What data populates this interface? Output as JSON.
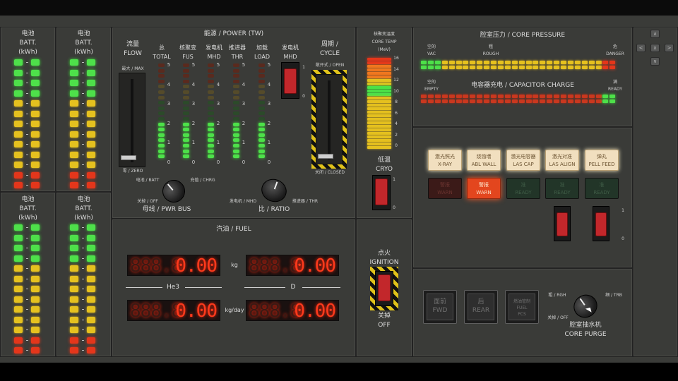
{
  "battery": {
    "title": "电池",
    "title_en": "BATT.",
    "unit": "(kWh)"
  },
  "power": {
    "header": "能源 / POWER (TW)",
    "flow": {
      "label": "流量",
      "label_en": "FLOW",
      "max": "最大 / MAX",
      "zero": "零 / ZERO"
    },
    "cols": [
      {
        "cn": "总",
        "en": "TOTAL"
      },
      {
        "cn": "核聚变",
        "en": "FUS"
      },
      {
        "cn": "发电机",
        "en": "MHD"
      },
      {
        "cn": "推进器",
        "en": "THR"
      },
      {
        "cn": "加载",
        "en": "LOAD"
      }
    ],
    "ticks": [
      "5",
      "4",
      "3",
      "2",
      "1",
      "0"
    ],
    "gen": {
      "cn": "发电机",
      "en": "MHD",
      "on": "1",
      "off": "0"
    },
    "cycle": {
      "label": "周期 /",
      "label_en": "CYCLE",
      "open": "敞开式 / OPEN",
      "closed": "关闭 / CLOSED"
    },
    "bus": {
      "batt": "电池 / BATT",
      "chrg": "充值 / CHRG",
      "off": "关掉 / OFF",
      "label": "母线 / PWR BUS"
    },
    "ratio": {
      "mhd": "发电机 / MHD",
      "thr": "推进器 / THR",
      "label": "比 / RATIO"
    }
  },
  "fuel": {
    "header": "汽油 / FUEL",
    "he3": "He3",
    "d": "D",
    "kg": "kg",
    "kgday": "kg/day",
    "ghost": "888.8",
    "values": [
      "0.00",
      "0.00",
      "0.00",
      "0.00"
    ]
  },
  "core_temp": {
    "label": "核聚变温度",
    "label_en": "CORE TEMP",
    "unit": "(MeV)",
    "ticks": [
      "16",
      "14",
      "12",
      "10",
      "8",
      "6",
      "4",
      "2",
      "0"
    ],
    "cryo": "低温",
    "cryo_en": "CRYO",
    "on": "1",
    "off": "0"
  },
  "ignition": {
    "label": "点火",
    "label_en": "IGNITION",
    "state": "关掉",
    "state_en": "OFF"
  },
  "core_pressure": {
    "header": "腔室压力 / CORE PRESSURE",
    "vac": "空的",
    "vac_en": "VAC",
    "rough": "粗",
    "rough_en": "ROUGH",
    "danger": "危",
    "danger_en": "DANGER"
  },
  "capacitor": {
    "header": "电容器充电 / CAPACITOR CHARGE",
    "empty": "空的",
    "empty_en": "EMPTY",
    "ready": "满",
    "ready_en": "READY"
  },
  "lasers": [
    {
      "cn": "激光照光",
      "en": "X-RAY"
    },
    {
      "cn": "烧蚀墙",
      "en": "ABL WALL"
    },
    {
      "cn": "激光电容器",
      "en": "LAS CAP"
    },
    {
      "cn": "激光对准",
      "en": "LAS ALIGN"
    },
    {
      "cn": "弹丸",
      "en": "PELL FEED"
    }
  ],
  "status": [
    {
      "cn": "警报",
      "en": "WARN"
    },
    {
      "cn": "警报",
      "en": "WARN"
    },
    {
      "cn": "准",
      "en": "READY"
    },
    {
      "cn": "准",
      "en": "READY"
    },
    {
      "cn": "准",
      "en": "READY"
    }
  ],
  "laser_toggles": {
    "on": "1",
    "off": "0"
  },
  "purge": {
    "fwd_cn": "面前",
    "fwd": "FWD",
    "rear_cn": "后",
    "rear": "REAR",
    "fuel_cn": "燃油管制",
    "fuel": "FUEL",
    "fuel2": "PCS",
    "rgh": "粗 / RGH",
    "trb": "细 / TRB",
    "off": "关掉 / OFF",
    "label": "腔室抽水机",
    "label_en": "CORE PURGE"
  },
  "nav": {
    "up": "∧",
    "left": "<",
    "close": "x",
    "right": ">",
    "down": "∨"
  }
}
